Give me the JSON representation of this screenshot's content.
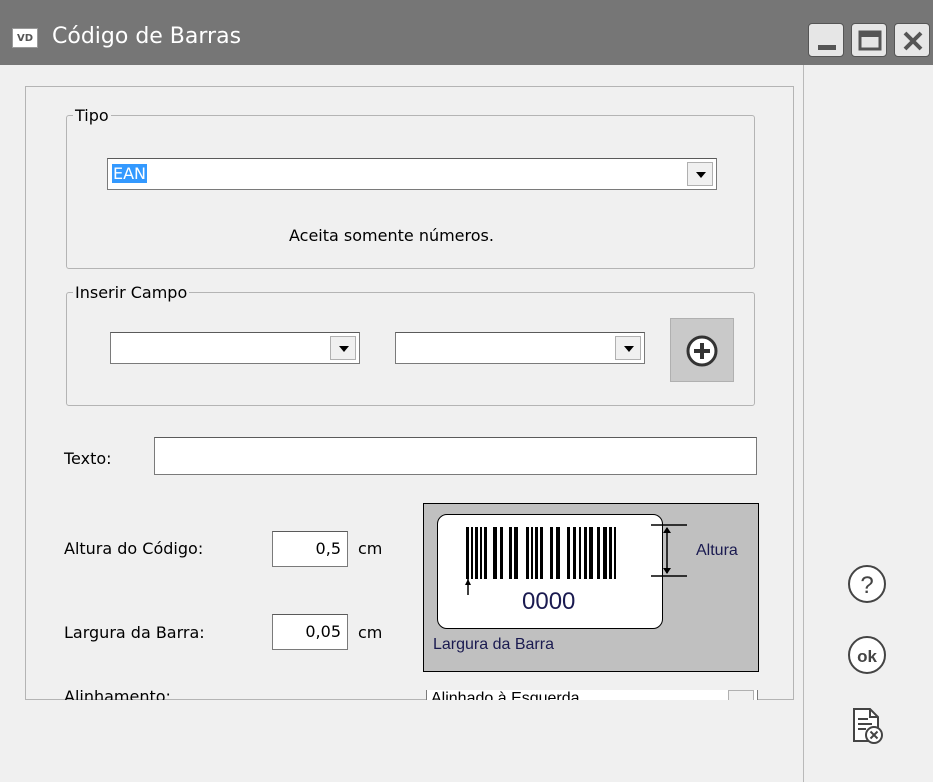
{
  "window": {
    "icon_text": "VD",
    "title": "Código de Barras"
  },
  "tipo": {
    "legend": "Tipo",
    "selected": "EAN",
    "hint": "Aceita somente números."
  },
  "inserir_campo": {
    "legend": "Inserir Campo"
  },
  "texto": {
    "label": "Texto:",
    "value": ""
  },
  "altura": {
    "label": "Altura do Código:",
    "value": "0,5",
    "unit": "cm"
  },
  "largura": {
    "label": "Largura da Barra:",
    "value": "0,05",
    "unit": "cm"
  },
  "alinhamento": {
    "label": "Alinhamento:",
    "selected": "Alinhado à Esquerda"
  },
  "preview": {
    "digits": "0000",
    "height_label": "Altura",
    "width_label": "Largura da Barra"
  },
  "side": {
    "help_icon": "help-icon",
    "ok_icon": "ok-icon",
    "cancel_icon": "document-cancel-icon"
  }
}
